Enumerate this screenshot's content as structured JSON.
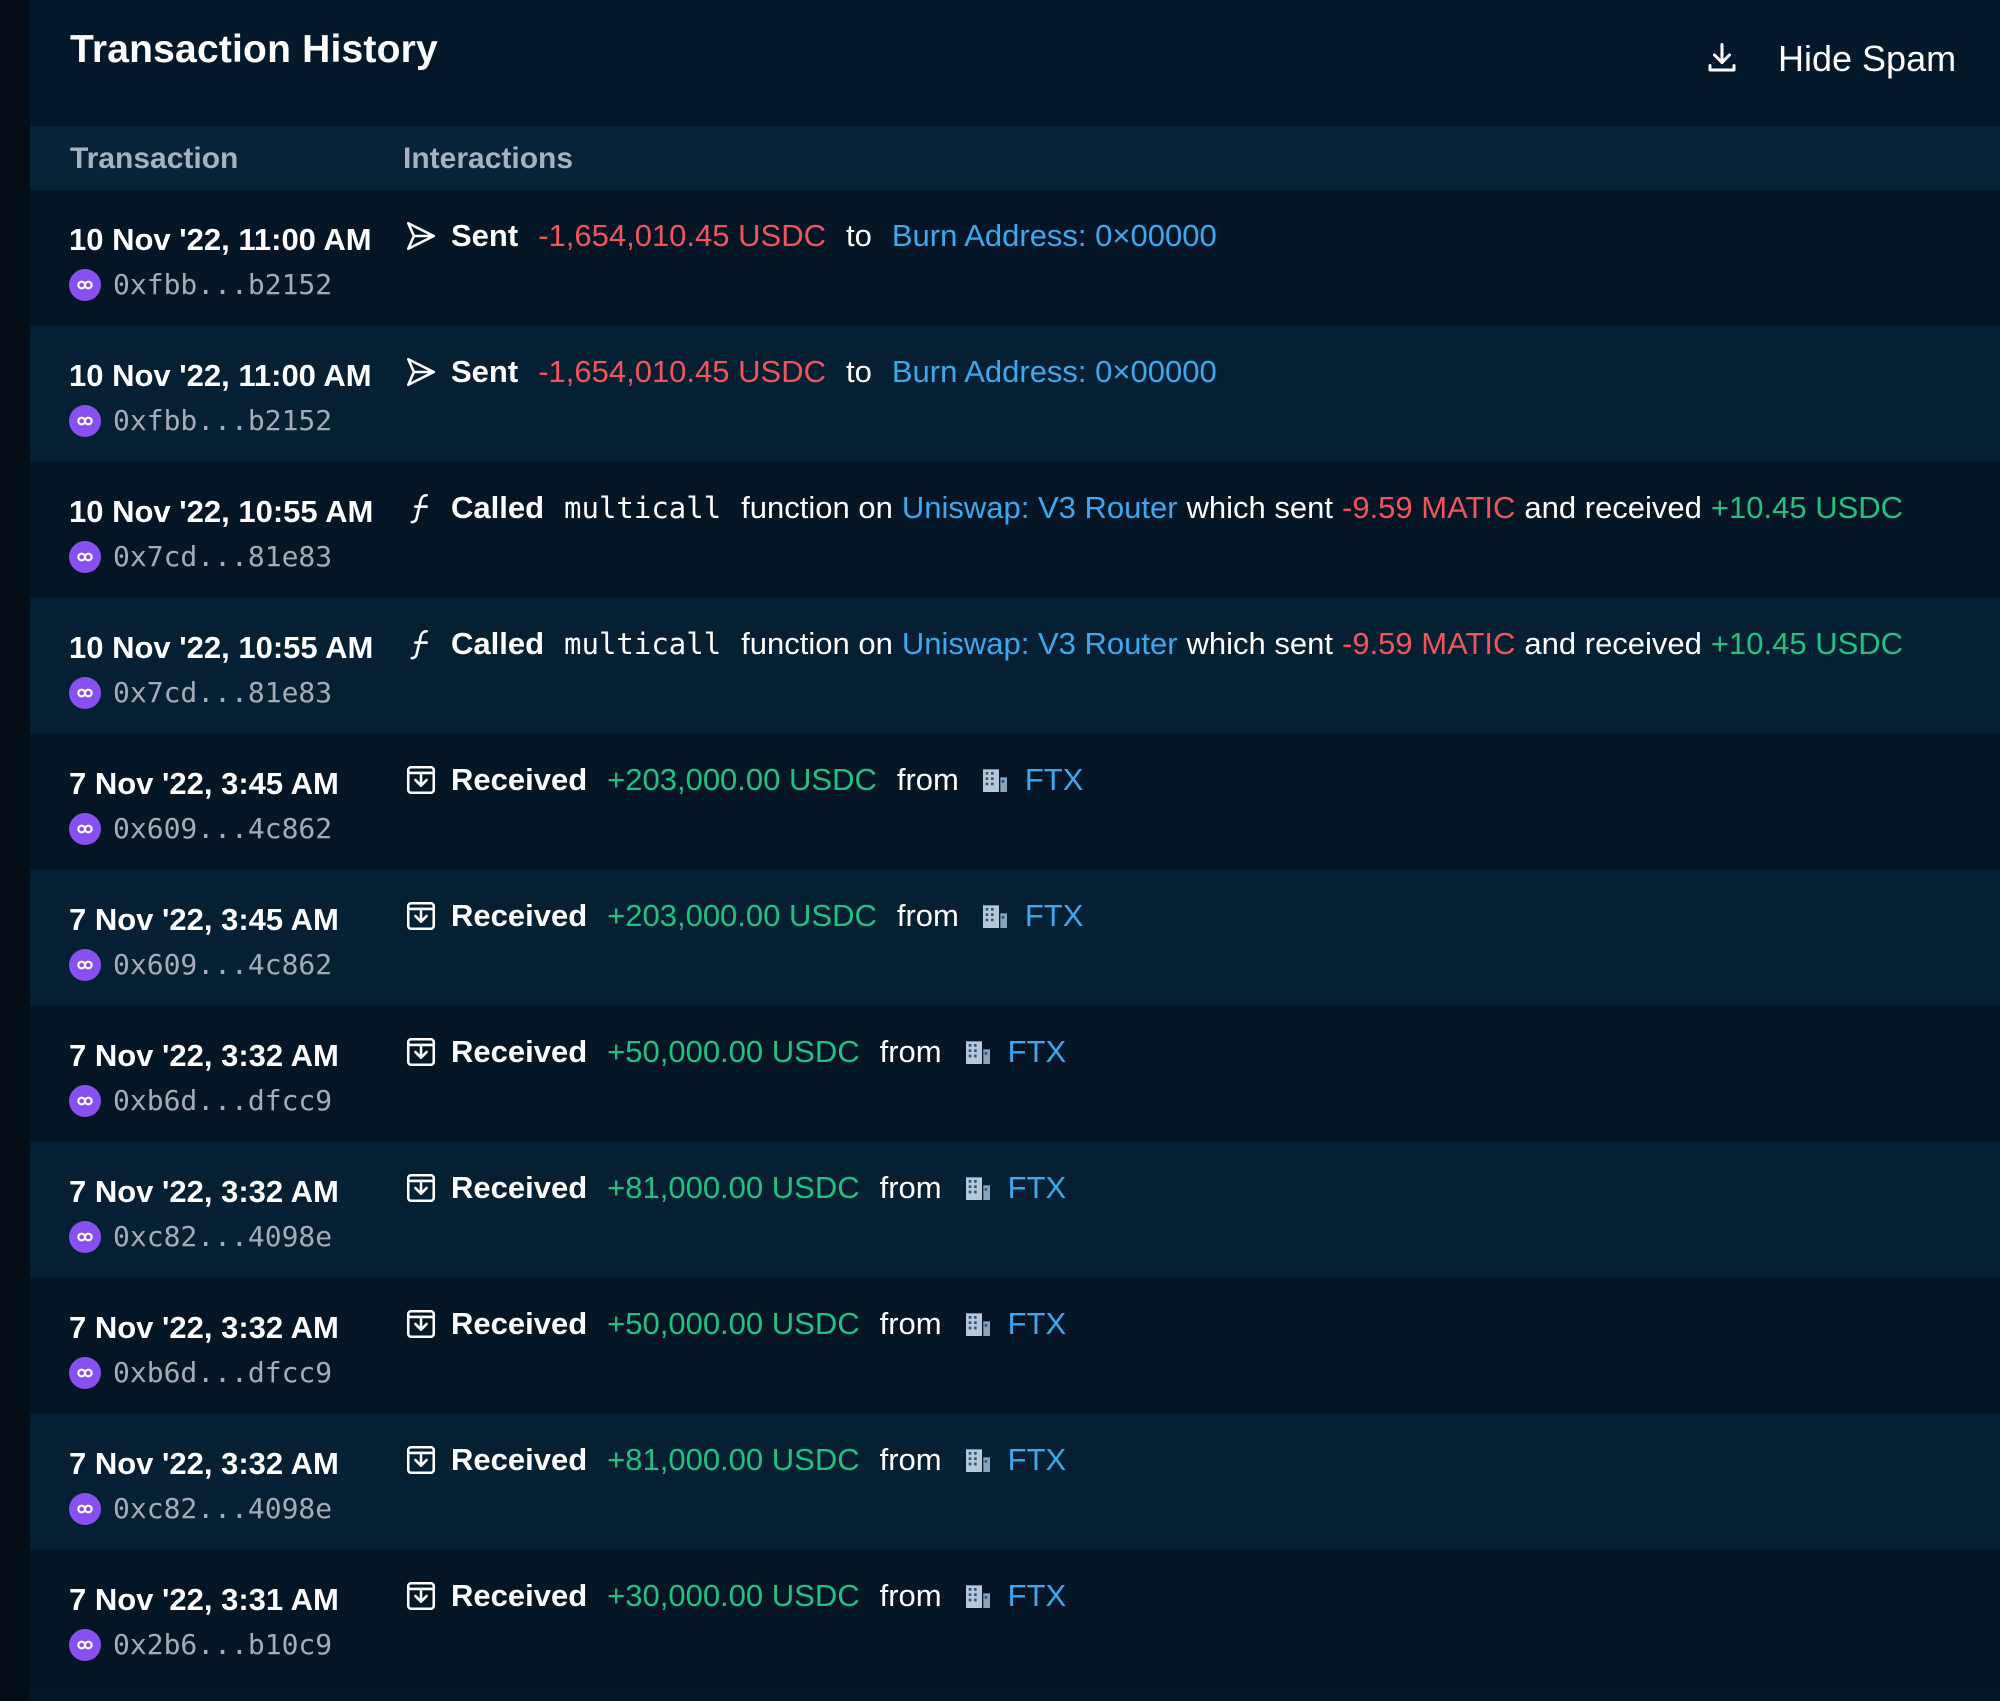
{
  "header": {
    "title": "Transaction History",
    "hide_spam_label": "Hide Spam",
    "hide_spam_on": true,
    "download_icon": "download-icon"
  },
  "columns": {
    "transaction": "Transaction",
    "interactions": "Interactions"
  },
  "colors": {
    "negative": "#f2545b",
    "positive": "#22c27e",
    "link": "#3ea8ef",
    "chain_purple": "#8a4ff0",
    "toggle_green": "#17c48d"
  },
  "rows": [
    {
      "date": "10 Nov '22, 11:00 AM",
      "hash": "0xfbb...b2152",
      "type": "sent",
      "verb": "Sent",
      "amount": "-1,654,010.45 USDC",
      "prep": "to",
      "counterparty": "Burn Address: 0×00000"
    },
    {
      "date": "10 Nov '22, 11:00 AM",
      "hash": "0xfbb...b2152",
      "type": "sent",
      "verb": "Sent",
      "amount": "-1,654,010.45 USDC",
      "prep": "to",
      "counterparty": "Burn Address: 0×00000"
    },
    {
      "date": "10 Nov '22, 10:55 AM",
      "hash": "0x7cd...81e83",
      "type": "called",
      "verb": "Called",
      "function": "multicall",
      "on_text": "function on",
      "contract": "Uniswap: V3 Router",
      "sent_text": "which sent",
      "sent_amount": "-9.59 MATIC",
      "recv_text": "and received",
      "recv_amount": "+10.45 USDC"
    },
    {
      "date": "10 Nov '22, 10:55 AM",
      "hash": "0x7cd...81e83",
      "type": "called",
      "verb": "Called",
      "function": "multicall",
      "on_text": "function on",
      "contract": "Uniswap: V3 Router",
      "sent_text": "which sent",
      "sent_amount": "-9.59 MATIC",
      "recv_text": "and received",
      "recv_amount": "+10.45 USDC"
    },
    {
      "date": "7 Nov '22, 3:45 AM",
      "hash": "0x609...4c862",
      "type": "received",
      "verb": "Received",
      "amount": "+203,000.00 USDC",
      "prep": "from",
      "counterparty": "FTX"
    },
    {
      "date": "7 Nov '22, 3:45 AM",
      "hash": "0x609...4c862",
      "type": "received",
      "verb": "Received",
      "amount": "+203,000.00 USDC",
      "prep": "from",
      "counterparty": "FTX"
    },
    {
      "date": "7 Nov '22, 3:32 AM",
      "hash": "0xb6d...dfcc9",
      "type": "received",
      "verb": "Received",
      "amount": "+50,000.00 USDC",
      "prep": "from",
      "counterparty": "FTX"
    },
    {
      "date": "7 Nov '22, 3:32 AM",
      "hash": "0xc82...4098e",
      "type": "received",
      "verb": "Received",
      "amount": "+81,000.00 USDC",
      "prep": "from",
      "counterparty": "FTX"
    },
    {
      "date": "7 Nov '22, 3:32 AM",
      "hash": "0xb6d...dfcc9",
      "type": "received",
      "verb": "Received",
      "amount": "+50,000.00 USDC",
      "prep": "from",
      "counterparty": "FTX"
    },
    {
      "date": "7 Nov '22, 3:32 AM",
      "hash": "0xc82...4098e",
      "type": "received",
      "verb": "Received",
      "amount": "+81,000.00 USDC",
      "prep": "from",
      "counterparty": "FTX"
    },
    {
      "date": "7 Nov '22, 3:31 AM",
      "hash": "0x2b6...b10c9",
      "type": "received",
      "verb": "Received",
      "amount": "+30,000.00 USDC",
      "prep": "from",
      "counterparty": "FTX"
    }
  ]
}
